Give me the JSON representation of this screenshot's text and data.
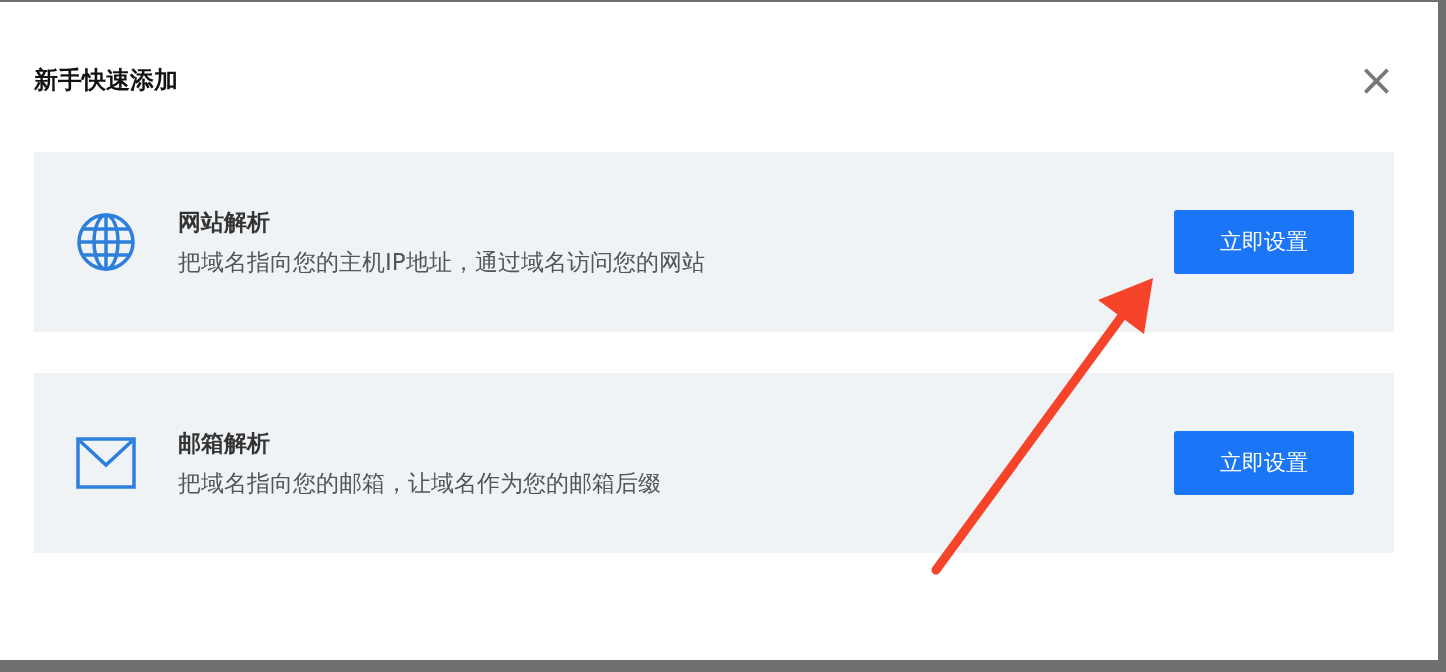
{
  "dialog": {
    "title": "新手快速添加",
    "close": "×"
  },
  "options": [
    {
      "kind": "globe",
      "title": "网站解析",
      "description": "把域名指向您的主机IP地址，通过域名访问您的网站",
      "button": "立即设置"
    },
    {
      "kind": "mail",
      "title": "邮箱解析",
      "description": "把域名指向您的邮箱，让域名作为您的邮箱后缀",
      "button": "立即设置"
    }
  ]
}
